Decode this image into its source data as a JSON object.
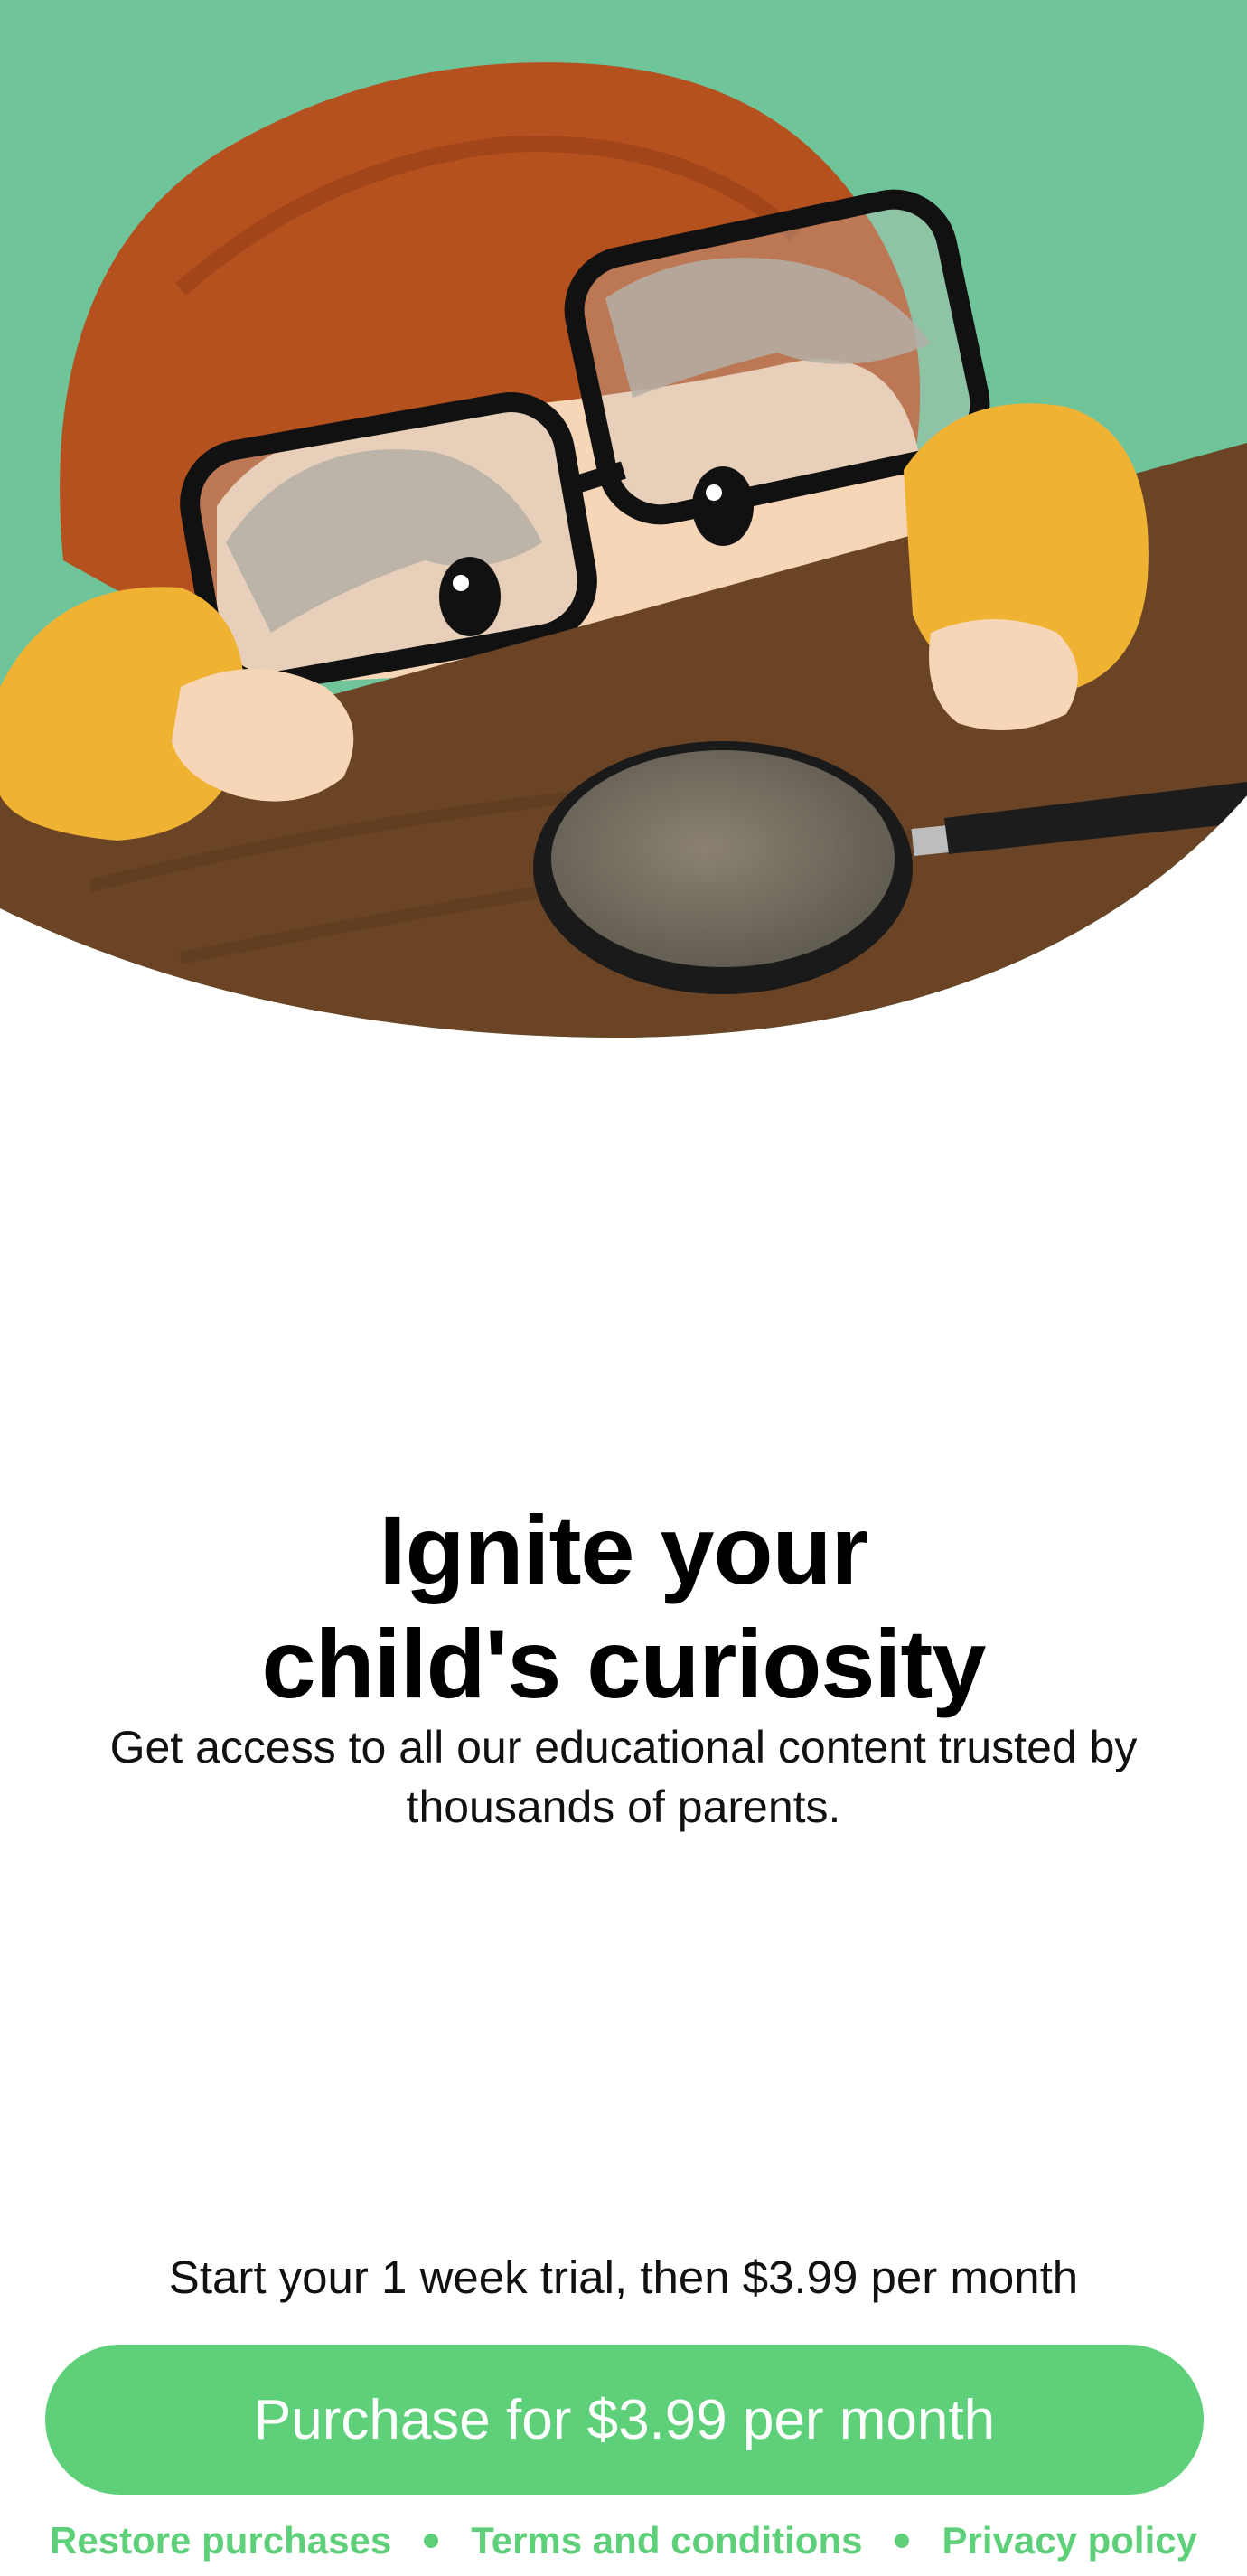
{
  "hero": {
    "illustration": "child-with-glasses-looking-at-magnifying-glass",
    "colors": {
      "wall": "#6fc49a",
      "hair": "#b5501f",
      "table": "#6b4425",
      "sleeve": "#f0b233",
      "skin": "#f7d6b8"
    }
  },
  "headline": {
    "line1": "Ignite your",
    "line2": "child's curiosity"
  },
  "subtitle": "Get access to all our educational content trusted by thousands of parents.",
  "trial_text": "Start your 1 week trial, then $3.99 per month",
  "purchase_button": {
    "label": "Purchase for $3.99 per month",
    "color": "#5fd07a"
  },
  "footer": {
    "restore": "Restore purchases",
    "terms": "Terms and conditions",
    "privacy": "Privacy policy",
    "link_color": "#5fd07a"
  }
}
